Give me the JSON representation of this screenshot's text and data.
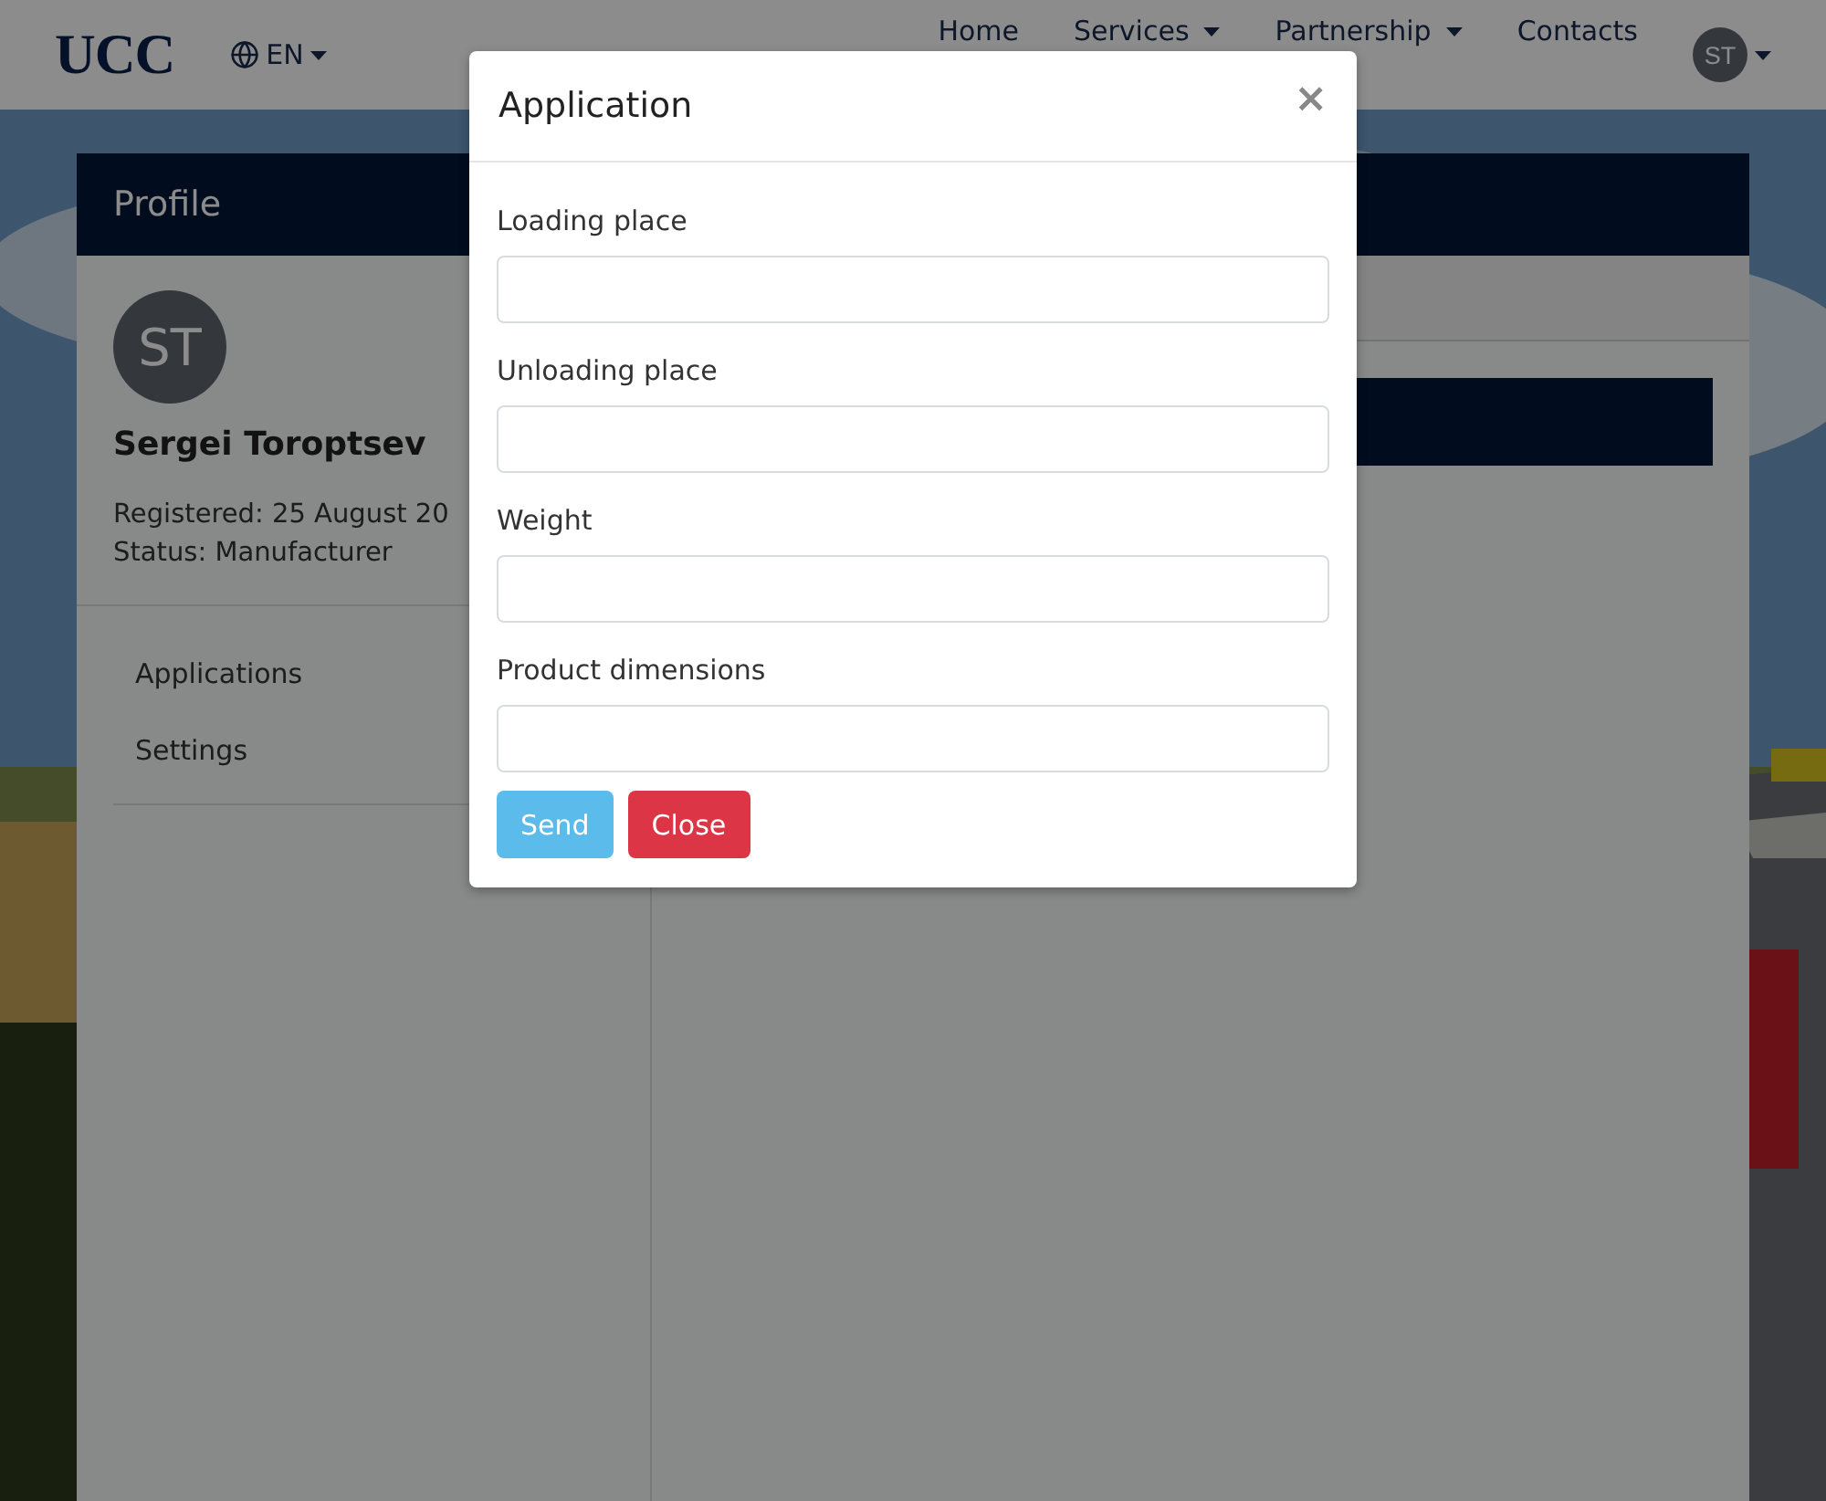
{
  "navbar": {
    "logo": "UCC",
    "language": {
      "label": "EN"
    },
    "links": [
      {
        "label": "Home",
        "dropdown": false
      },
      {
        "label": "Services",
        "dropdown": true
      },
      {
        "label": "Partnership",
        "dropdown": true
      },
      {
        "label": "Contacts",
        "dropdown": false
      }
    ],
    "user": {
      "initials": "ST"
    }
  },
  "profile": {
    "title": "Profile",
    "avatar_initials": "ST",
    "name": "Sergei Toroptsev",
    "details": [
      "Registered: 25 August 20",
      "Status: Manufacturer"
    ],
    "menu": [
      "Applications",
      "Settings"
    ]
  },
  "modal": {
    "title": "Application",
    "close": "×",
    "fields": [
      {
        "label": "Loading place"
      },
      {
        "label": "Unloading place"
      },
      {
        "label": "Weight"
      },
      {
        "label": "Product dimensions"
      }
    ],
    "buttons": [
      {
        "label": "Send",
        "kind": "primary"
      },
      {
        "label": "Close",
        "kind": "danger"
      }
    ]
  }
}
